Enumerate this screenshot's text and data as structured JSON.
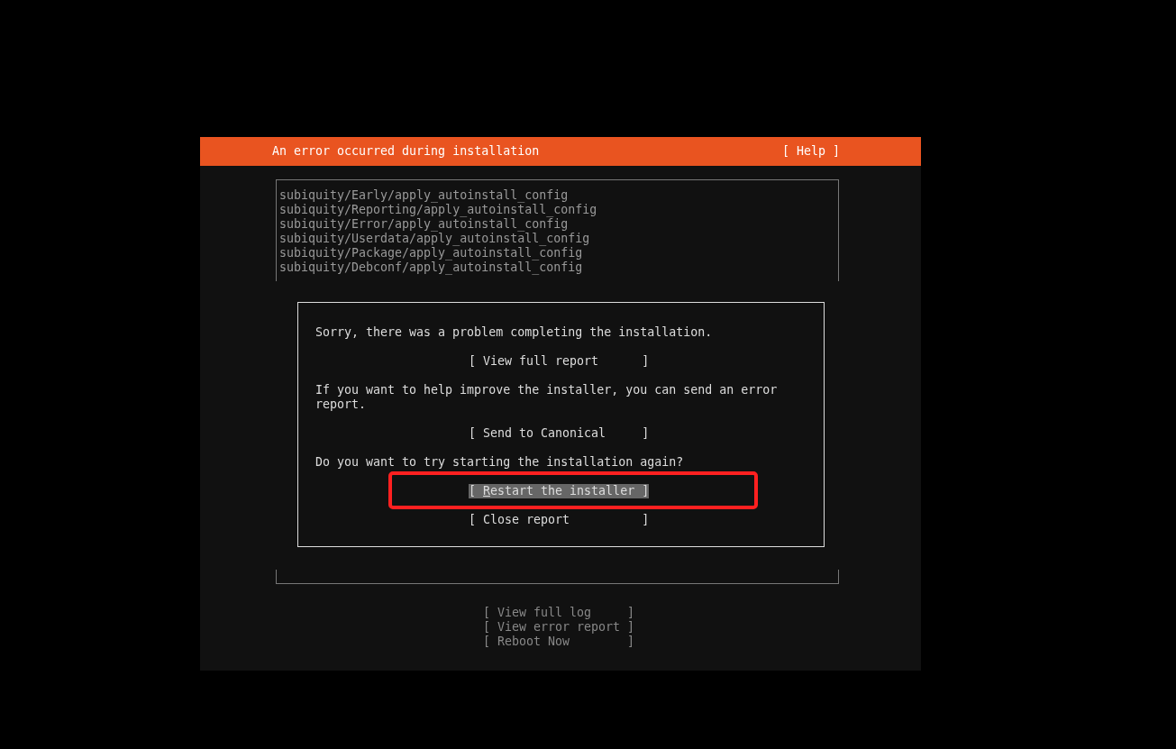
{
  "header": {
    "title": "An error occurred during installation",
    "help": "[ Help ]"
  },
  "log": {
    "lines": [
      "subiquity/Early/apply_autoinstall_config",
      "subiquity/Reporting/apply_autoinstall_config",
      "subiquity/Error/apply_autoinstall_config",
      "subiquity/Userdata/apply_autoinstall_config",
      "subiquity/Package/apply_autoinstall_config",
      "subiquity/Debconf/apply_autoinstall_config"
    ]
  },
  "dialog": {
    "items": [
      {
        "kind": "text",
        "text": "Sorry, there was a problem completing the installation."
      },
      {
        "kind": "button",
        "label": "[ View full report      ]",
        "selected": false
      },
      {
        "kind": "text",
        "text": "If you want to help improve the installer, you can send an error report."
      },
      {
        "kind": "button",
        "label": "[ Send to Canonical     ]",
        "selected": false
      },
      {
        "kind": "text",
        "text": "Do you want to try starting the installation again?"
      },
      {
        "kind": "button",
        "label": "[ Restart the installer ]",
        "selected": true
      },
      {
        "kind": "button",
        "label": "[ Close report          ]",
        "selected": false
      }
    ],
    "annotation": {
      "kind": "rectangle"
    }
  },
  "footer_buttons": [
    {
      "label": "[ View full log     ]",
      "disabled": true
    },
    {
      "label": "[ View error report ]",
      "disabled": true
    },
    {
      "label": "[ Reboot Now        ]",
      "disabled": true
    }
  ]
}
